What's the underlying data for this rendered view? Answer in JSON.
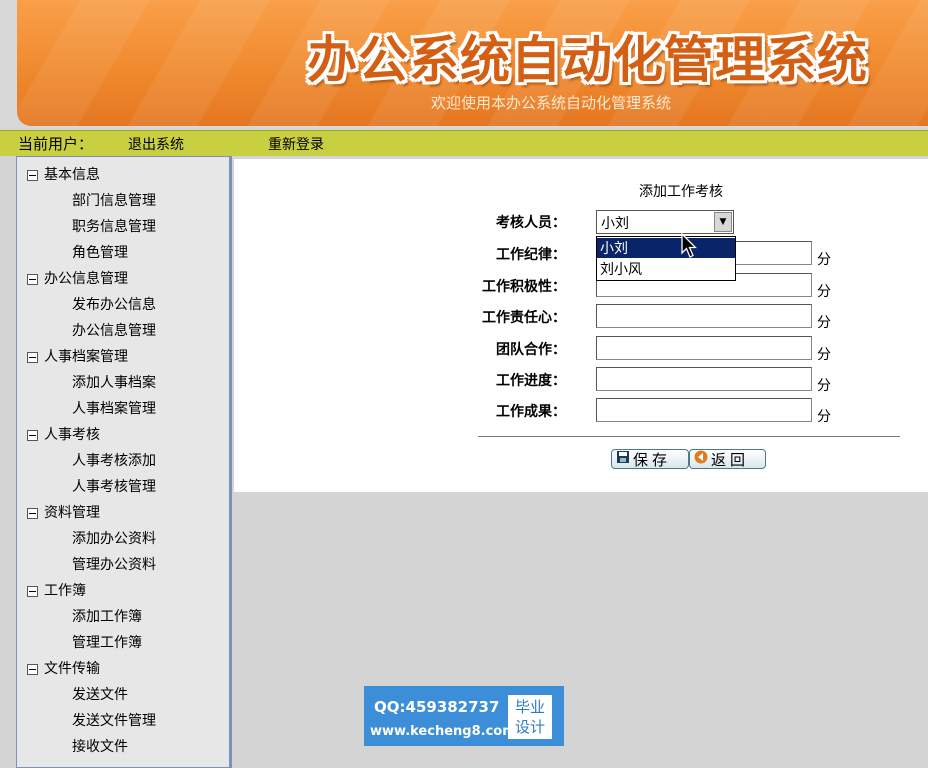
{
  "header": {
    "title": "办公系统自动化管理系统",
    "subtitle": "欢迎使用本办公系统自动化管理系统"
  },
  "userbar": {
    "current_user_label": "当前用户：",
    "logout": "退出系统",
    "relogin": "重新登录"
  },
  "sidebar": {
    "groups": [
      {
        "title": "基本信息",
        "items": [
          "部门信息管理",
          "职务信息管理",
          "角色管理"
        ]
      },
      {
        "title": "办公信息管理",
        "items": [
          "发布办公信息",
          "办公信息管理"
        ]
      },
      {
        "title": "人事档案管理",
        "items": [
          "添加人事档案",
          "人事档案管理"
        ]
      },
      {
        "title": "人事考核",
        "items": [
          "人事考核添加",
          "人事考核管理"
        ]
      },
      {
        "title": "资料管理",
        "items": [
          "添加办公资料",
          "管理办公资料"
        ]
      },
      {
        "title": "工作簿",
        "items": [
          "添加工作簿",
          "管理工作簿"
        ]
      },
      {
        "title": "文件传输",
        "items": [
          "发送文件",
          "发送文件管理",
          "接收文件"
        ]
      }
    ]
  },
  "form": {
    "title": "添加工作考核",
    "reviewer_label": "考核人员：",
    "reviewer_selected": "小刘",
    "reviewer_options": [
      "小刘",
      "刘小风"
    ],
    "fields": [
      {
        "label": "工作纪律：",
        "value": "",
        "unit": "分"
      },
      {
        "label": "工作积极性：",
        "value": "",
        "unit": "分"
      },
      {
        "label": "工作责任心：",
        "value": "",
        "unit": "分"
      },
      {
        "label": "团队合作：",
        "value": "",
        "unit": "分"
      },
      {
        "label": "工作进度：",
        "value": "",
        "unit": "分"
      },
      {
        "label": "工作成果：",
        "value": "",
        "unit": "分"
      }
    ],
    "save_label": "保存",
    "back_label": "返回"
  },
  "watermark": {
    "qq": "QQ:459382737",
    "url": "www.kecheng8.com",
    "badge_line1": "毕业",
    "badge_line2": "设计"
  },
  "icons": {
    "toggle": "collapse-minus-icon",
    "save": "floppy-disk-icon",
    "back": "back-arrow-icon",
    "cursor": "mouse-pointer-icon"
  },
  "colors": {
    "banner": "#f08a2e",
    "userbar": "#c8d042",
    "sidebar_border": "#7e8fb9",
    "selected_option": "#0a246a"
  }
}
